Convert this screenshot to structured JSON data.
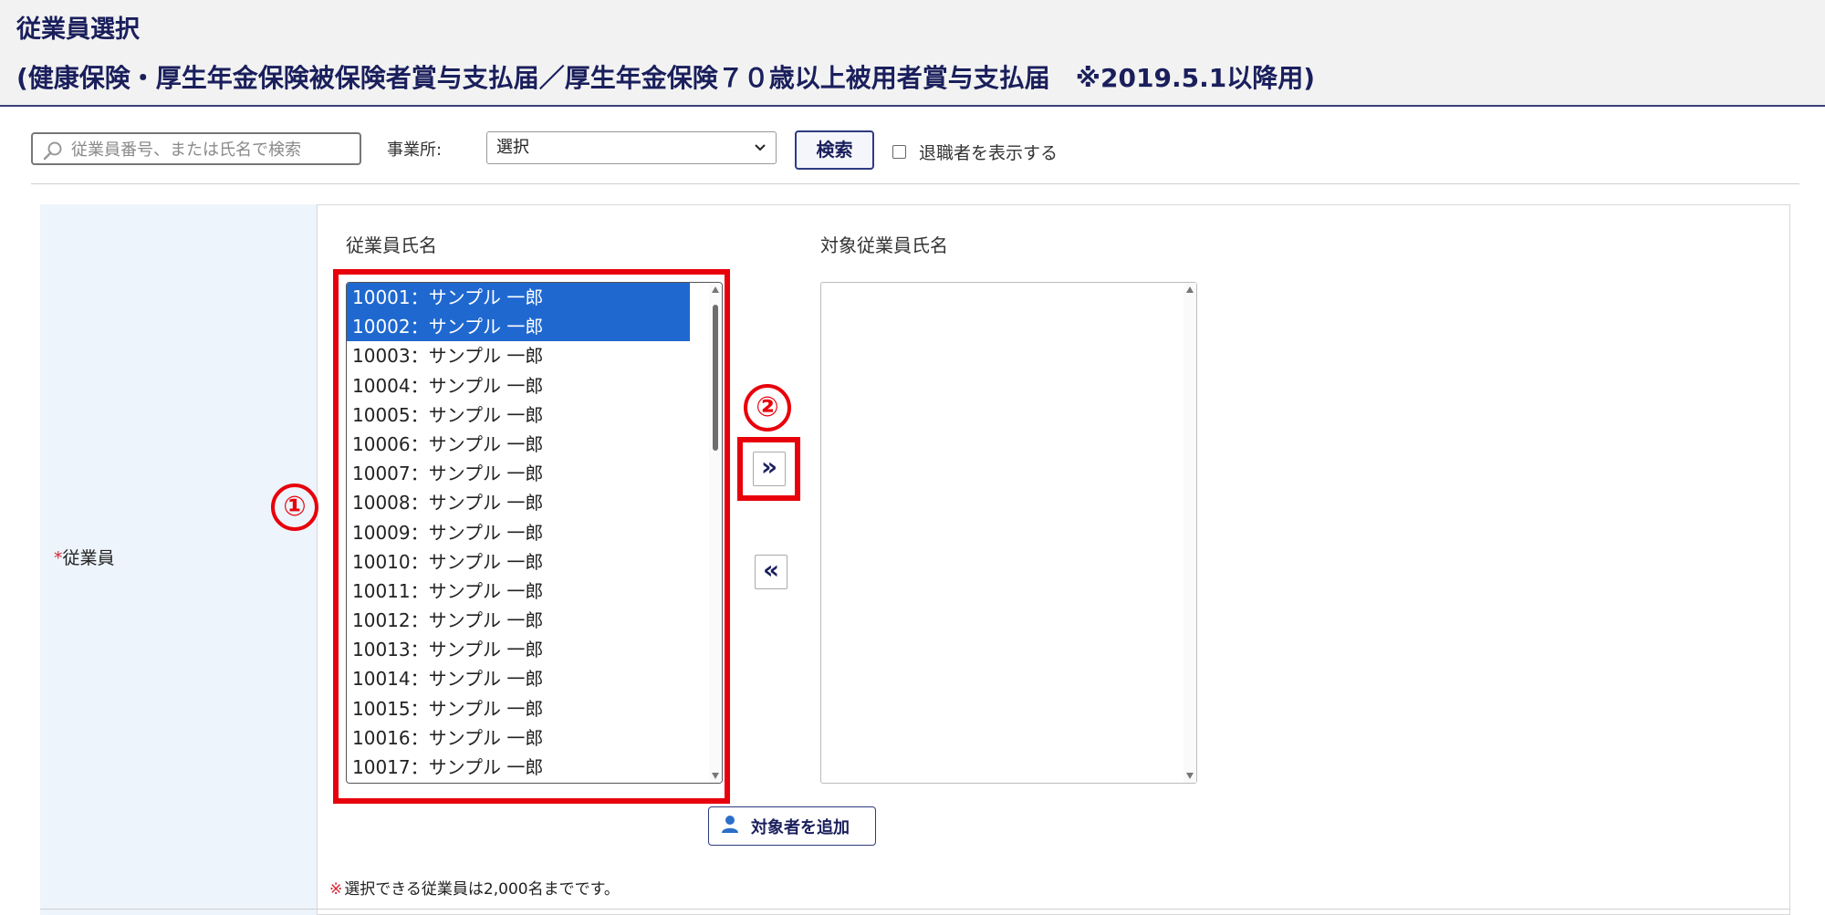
{
  "header": {
    "title": "従業員選択",
    "subtitle": "(健康保険・厚生年金保険被保険者賞与支払届／厚生年金保険７０歳以上被用者賞与支払届　※2019.5.1以降用)"
  },
  "toolbar": {
    "search_placeholder": "従業員番号、または氏名で検索",
    "office_label": "事業所:",
    "office_selected": "選択",
    "search_button": "検索",
    "retired_label": "退職者を表示する"
  },
  "form": {
    "required_mark": "*",
    "employee_label": "従業員",
    "employee_list_header": "従業員氏名",
    "target_list_header": "対象従業員氏名",
    "employees": [
      {
        "label": "10001：サンプル 一郎",
        "selected": true
      },
      {
        "label": "10002：サンプル 一郎",
        "selected": true
      },
      {
        "label": "10003：サンプル 一郎",
        "selected": false
      },
      {
        "label": "10004：サンプル 一郎",
        "selected": false
      },
      {
        "label": "10005：サンプル 一郎",
        "selected": false
      },
      {
        "label": "10006：サンプル 一郎",
        "selected": false
      },
      {
        "label": "10007：サンプル 一郎",
        "selected": false
      },
      {
        "label": "10008：サンプル 一郎",
        "selected": false
      },
      {
        "label": "10009：サンプル 一郎",
        "selected": false
      },
      {
        "label": "10010：サンプル 一郎",
        "selected": false
      },
      {
        "label": "10011：サンプル 一郎",
        "selected": false
      },
      {
        "label": "10012：サンプル 一郎",
        "selected": false
      },
      {
        "label": "10013：サンプル 一郎",
        "selected": false
      },
      {
        "label": "10014：サンプル 一郎",
        "selected": false
      },
      {
        "label": "10015：サンプル 一郎",
        "selected": false
      },
      {
        "label": "10016：サンプル 一郎",
        "selected": false
      },
      {
        "label": "10017：サンプル 一郎",
        "selected": false
      }
    ],
    "target_employees": [],
    "move_right_label": "»",
    "move_left_label": "«",
    "add_button": "対象者を追加",
    "note_mark": "※",
    "note": "選択できる従業員は2,000名までです。"
  },
  "annotations": {
    "marker_1": "①",
    "marker_2": "②",
    "color": "#e8000b"
  },
  "colors": {
    "selected_row": "#1f68d0",
    "brand_navy": "#1a1f5c",
    "label_bg": "#edf4fc"
  },
  "icons": [
    "search-icon",
    "chevron-down-icon",
    "double-chevron-right-icon",
    "double-chevron-left-icon",
    "user-icon"
  ]
}
